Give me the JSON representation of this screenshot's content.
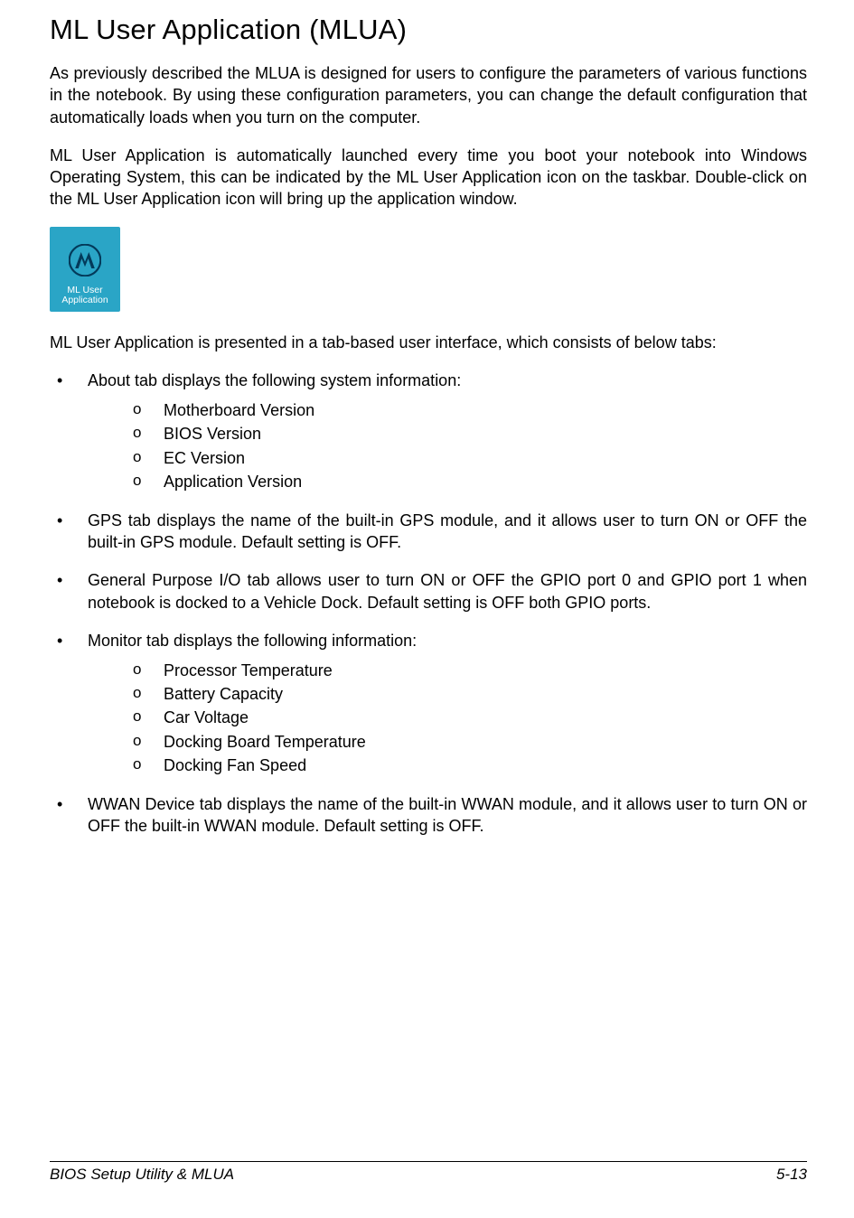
{
  "heading": "ML User Application (MLUA)",
  "paragraph1": "As previously described the MLUA is designed for users to configure the parameters of various functions in the notebook. By using these configuration parameters, you can change the default configuration that automatically loads when you turn on the computer.",
  "paragraph2": "ML User Application is automatically launched every time you boot your notebook into Windows Operating System, this can be indicated by the ML User Application icon on the taskbar. Double-click on the ML User Application icon will bring up the application window.",
  "icon": {
    "line1": "ML User",
    "line2": "Application"
  },
  "paragraph3": "ML User Application is presented in a tab-based user interface, which consists of below tabs:",
  "bullets": [
    {
      "text": "About tab displays the following system information:",
      "sub": [
        "Motherboard Version",
        "BIOS Version",
        "EC Version",
        "Application Version"
      ]
    },
    {
      "text": "GPS tab displays the name of the built-in GPS module, and it allows user to turn ON or OFF the built-in GPS module. Default setting is OFF."
    },
    {
      "text": "General Purpose I/O tab allows user to turn ON or OFF the GPIO port 0 and GPIO port 1 when notebook is docked to a Vehicle Dock. Default setting is OFF both GPIO ports."
    },
    {
      "text": "Monitor tab displays the following information:",
      "sub": [
        "Processor Temperature",
        "Battery Capacity",
        "Car Voltage",
        "Docking Board Temperature",
        "Docking Fan Speed"
      ]
    },
    {
      "text": "WWAN Device tab displays the name of the built-in WWAN module, and it allows user to turn ON or OFF the built-in WWAN module. Default setting is OFF."
    }
  ],
  "footer": {
    "left": "BIOS Setup Utility & MLUA",
    "right": "5-13"
  }
}
